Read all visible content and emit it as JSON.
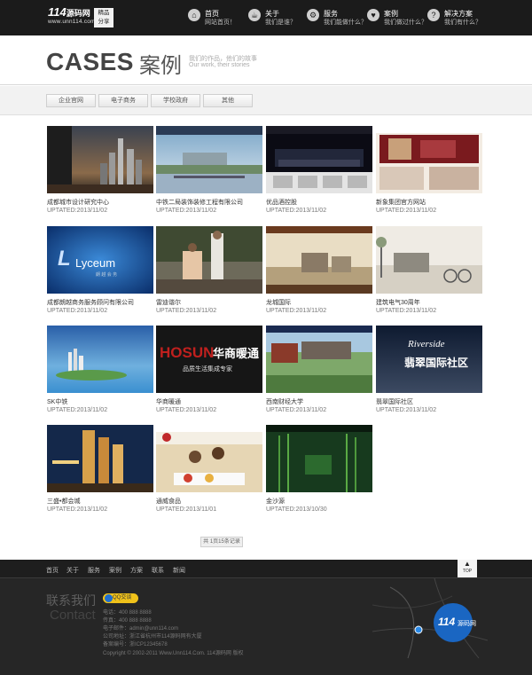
{
  "header": {
    "logo_main": "114",
    "logo_cn": "源码网",
    "logo_url": "www.unn114.com",
    "badge_line1": "精品",
    "badge_line2": "分享",
    "nav": [
      {
        "icon": "home-icon",
        "glyph": "⌂",
        "title": "首页",
        "sub": "网站首页！"
      },
      {
        "icon": "coffee-icon",
        "glyph": "☕",
        "title": "关于",
        "sub": "我们是谁？"
      },
      {
        "icon": "gear-icon",
        "glyph": "⚙",
        "title": "服务",
        "sub": "我们能做什么？"
      },
      {
        "icon": "heart-icon",
        "glyph": "♥",
        "title": "案例",
        "sub": "我们做过什么？"
      },
      {
        "icon": "question-icon",
        "glyph": "?",
        "title": "解决方案",
        "sub": "我们有什么？"
      }
    ]
  },
  "banner": {
    "title": "CASES",
    "title_cn": "案例",
    "sub1": "我们的作品，他们的故事",
    "sub2": "Our work, their stories"
  },
  "filters": [
    "企业官网",
    "电子商务",
    "学校政府",
    "其他"
  ],
  "cases": [
    {
      "name": "成都城市设计研究中心",
      "date": "UPTATED:2013/11/02"
    },
    {
      "name": "中铁二局装饰装修工程有限公司",
      "date": "UPTATED:2013/11/02"
    },
    {
      "name": "优品酒控股",
      "date": "UPTATED:2013/11/02"
    },
    {
      "name": "新象集团官方网站",
      "date": "UPTATED:2013/11/02"
    },
    {
      "name": "成都朗越商务服务顾问有限公司",
      "date": "UPTATED:2013/11/02"
    },
    {
      "name": "雷迪谐尔",
      "date": "UPTATED:2013/11/02"
    },
    {
      "name": "龙城国际",
      "date": "UPTATED:2013/11/02"
    },
    {
      "name": "建筑电气30周年",
      "date": "UPTATED:2013/11/02"
    },
    {
      "name": "SK中铁",
      "date": "UPTATED:2013/11/02"
    },
    {
      "name": "华商暖通",
      "date": "UPTATED:2013/11/02"
    },
    {
      "name": "西南财经大学",
      "date": "UPTATED:2013/11/02"
    },
    {
      "name": "翡翠国际社区",
      "date": "UPTATED:2013/11/02"
    },
    {
      "name": "三盛•都会城",
      "date": "UPTATED:2013/11/02"
    },
    {
      "name": "通威食品",
      "date": "UPTATED:2013/11/01"
    },
    {
      "name": "金沙源",
      "date": "UPTATED:2013/10/30"
    }
  ],
  "thumb_text": {
    "lyceum": "Lyceum",
    "lyceum_small": "朗 越 会 务",
    "hosun": "HOSUN",
    "hosun_cn": "华商暖通",
    "hosun_slogan": "品质生活集成专家",
    "riverside": "Riverside",
    "riverside_cn": "翡翠国际社区"
  },
  "pager": "共 1页15条记录",
  "footer": {
    "nav": [
      "首页",
      "关于",
      "服务",
      "案例",
      "方案",
      "联系",
      "新闻"
    ],
    "top_label": "TOP",
    "contact_cn": "联系我们",
    "contact_en": "Contact",
    "qq_label": "QQ交谈",
    "lines": [
      "电话：400 888 8888",
      "传真：400 888 8888",
      "电子邮件：admin@unn114.com",
      "公司地址：浙江省杭州市114源码网有大厦",
      "备案编号：浙ICP12345678",
      "Copyright © 2002-2011 Www.Unn114.Com. 114源码网 版权"
    ],
    "map_logo": "114",
    "map_logo_cn": "源码网"
  }
}
